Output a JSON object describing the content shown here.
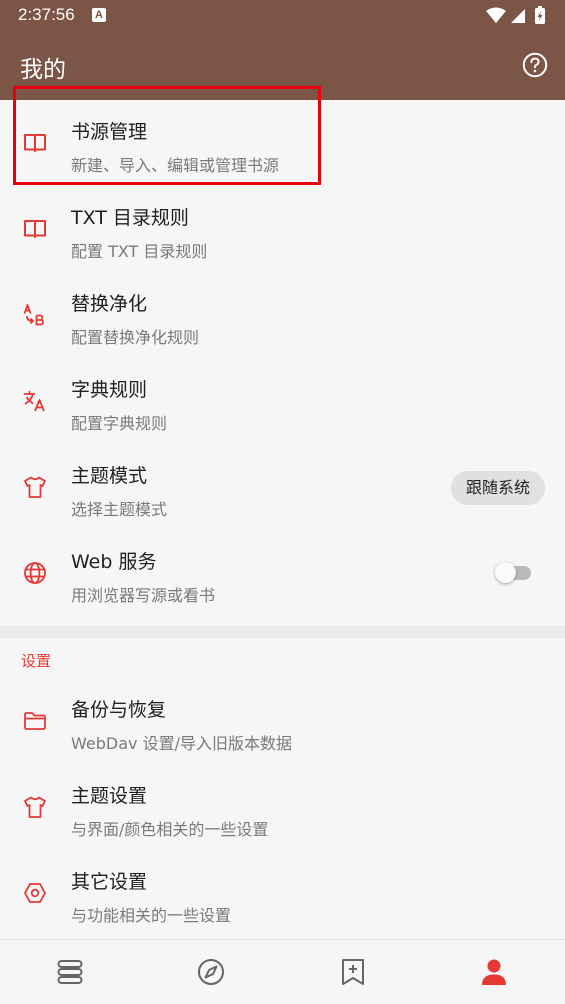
{
  "status_bar": {
    "time": "2:37:56",
    "notification_badge": "A"
  },
  "app_bar": {
    "title": "我的",
    "help_icon": "help-circle-icon"
  },
  "rows": [
    {
      "title": "书源管理",
      "subtitle": "新建、导入、编辑或管理书源",
      "icon": "book-open-icon"
    },
    {
      "title": "TXT 目录规则",
      "subtitle": "配置 TXT 目录规则",
      "icon": "book-open-icon"
    },
    {
      "title": "替换净化",
      "subtitle": "配置替换净化规则",
      "icon": "replace-ab-icon"
    },
    {
      "title": "字典规则",
      "subtitle": "配置字典规则",
      "icon": "translate-icon"
    },
    {
      "title": "主题模式",
      "subtitle": "选择主题模式",
      "icon": "tshirt-icon",
      "chip": "跟随系统"
    },
    {
      "title": "Web 服务",
      "subtitle": "用浏览器写源或看书",
      "icon": "globe-icon",
      "toggle": false
    }
  ],
  "settings_section": {
    "header": "设置",
    "rows": [
      {
        "title": "备份与恢复",
        "subtitle": "WebDav 设置/导入旧版本数据",
        "icon": "folder-icon"
      },
      {
        "title": "主题设置",
        "subtitle": "与界面/颜色相关的一些设置",
        "icon": "tshirt-icon"
      },
      {
        "title": "其它设置",
        "subtitle": "与功能相关的一些设置",
        "icon": "hexagon-settings-icon"
      }
    ]
  },
  "bottom_nav": {
    "items": [
      {
        "name": "bookshelf",
        "icon": "bookshelf-icon",
        "active": false
      },
      {
        "name": "discover",
        "icon": "compass-icon",
        "active": false
      },
      {
        "name": "rss",
        "icon": "bookmark-plus-icon",
        "active": false
      },
      {
        "name": "my",
        "icon": "person-icon",
        "active": true
      }
    ]
  },
  "colors": {
    "primary": "#7b5545",
    "accent": "#e53935",
    "highlight_box": "#e8000b",
    "nav_inactive": "#666666"
  }
}
